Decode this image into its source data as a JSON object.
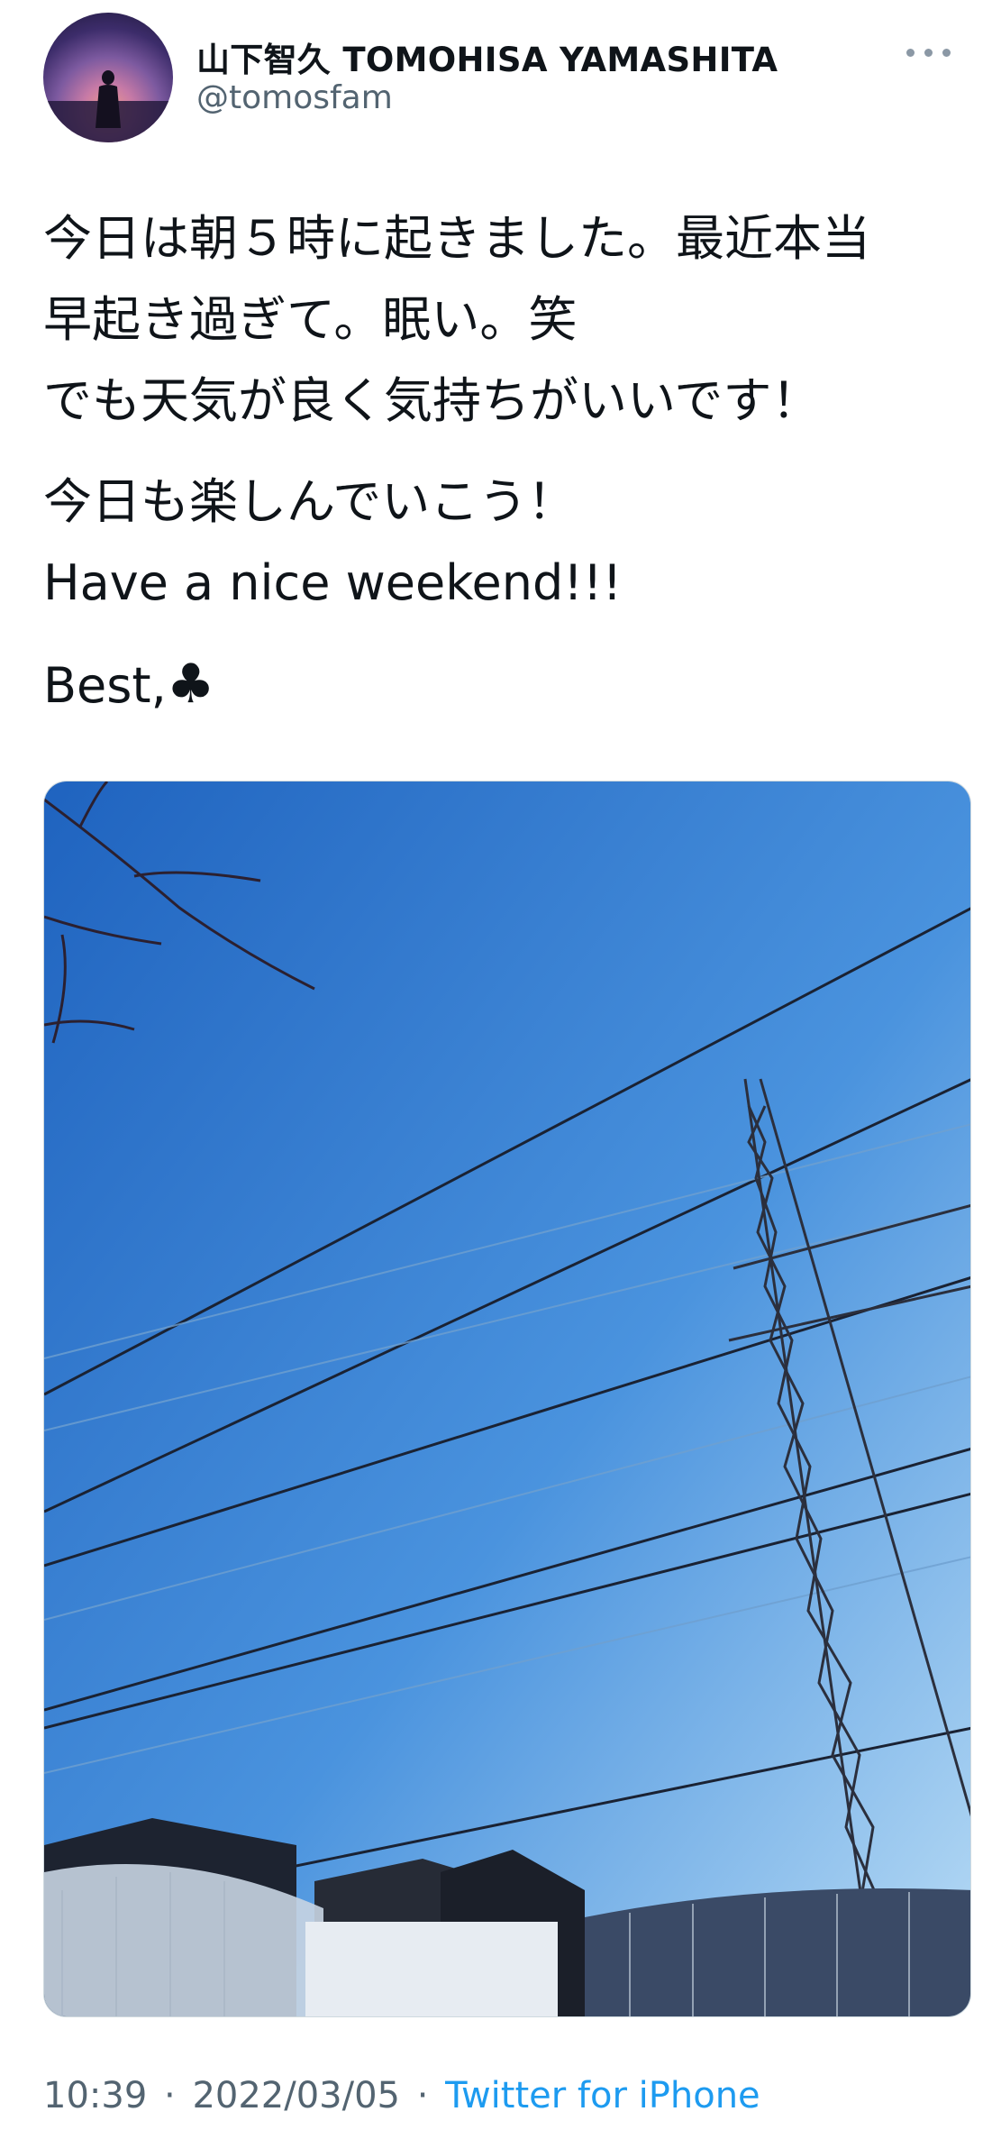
{
  "user": {
    "display_name": "山下智久 TOMOHISA YAMASHITA",
    "handle": "@tomosfam",
    "avatar_icon": "profile-photo-silhouette"
  },
  "tweet": {
    "paragraphs": [
      "今日は朝５時に起きました。最近本当\n早起き過ぎて。眠い。笑\nでも天気が良く気持ちがいいです！",
      "今日も楽しんでいこう！\nHave a nice weekend!!!",
      "Best,"
    ],
    "emoji": "♣"
  },
  "media": {
    "description_icon": "photo-sky-power-tower"
  },
  "meta": {
    "time": "10:39",
    "separator": "·",
    "date": "2022/03/05",
    "source": "Twitter for iPhone"
  },
  "colors": {
    "text_primary": "#0f1419",
    "text_secondary": "#536471",
    "link": "#1d9bf0",
    "sky_top": "#2c72c8",
    "sky_bottom": "#a9d1f2"
  }
}
